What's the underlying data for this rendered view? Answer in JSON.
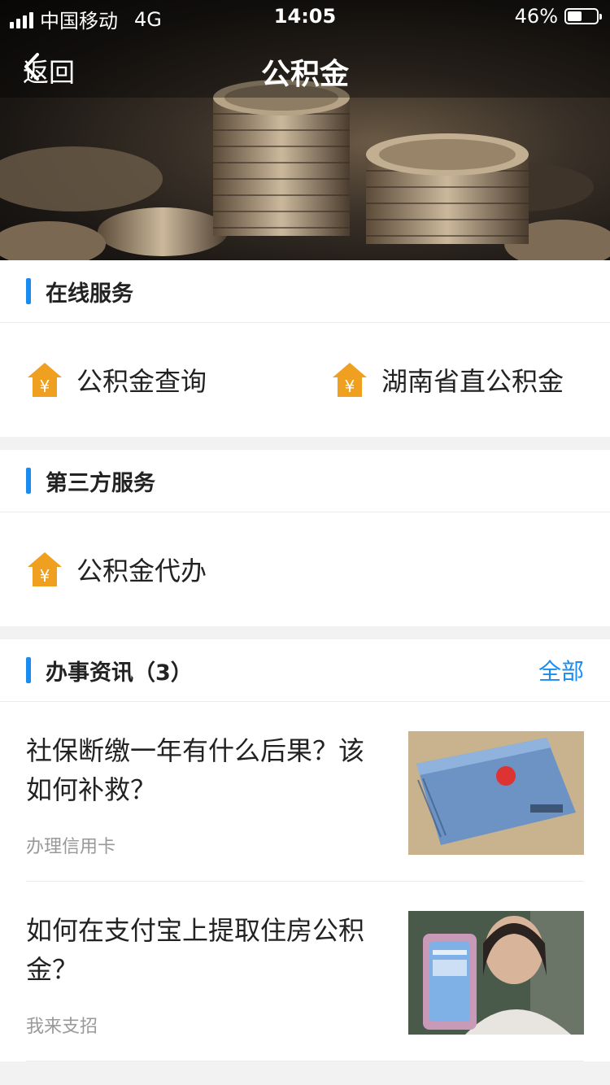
{
  "status": {
    "carrier": "中国移动",
    "network": "4G",
    "time": "14:05",
    "battery": "46%",
    "battery_level": 0.46
  },
  "nav": {
    "back": "返回",
    "title": "公积金"
  },
  "sections": {
    "online": {
      "title": "在线服务",
      "items": [
        "公积金查询",
        "湖南省直公积金"
      ]
    },
    "third": {
      "title": "第三方服务",
      "items": [
        "公积金代办"
      ]
    },
    "news": {
      "title": "办事资讯（3）",
      "more": "全部",
      "items": [
        {
          "title": "社保断缴一年有什么后果？该如何补救？",
          "source": "办理信用卡"
        },
        {
          "title": "如何在支付宝上提取住房公积金？",
          "source": "我来支招"
        }
      ]
    }
  },
  "colors": {
    "accent": "#1a8cf0",
    "icon": "#f0a020"
  }
}
